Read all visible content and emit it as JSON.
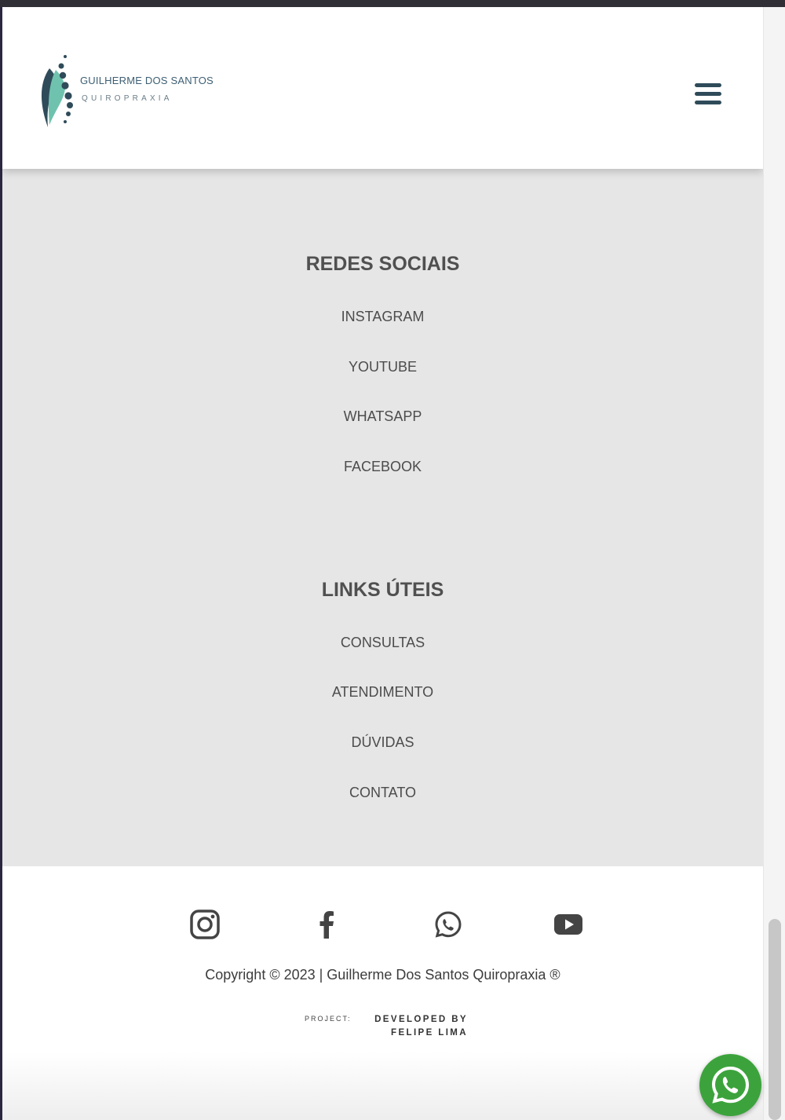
{
  "header": {
    "logo_name": "GUILHERME DOS SANTOS",
    "logo_subtitle": "QUIROPRAXIA",
    "menu_icon": "hamburger-menu-icon"
  },
  "social_column": {
    "title": "REDES SOCIAIS",
    "links": [
      "INSTAGRAM",
      "YOUTUBE",
      "WHATSAPP",
      "FACEBOOK"
    ]
  },
  "useful_column": {
    "title": "LINKS ÚTEIS",
    "links": [
      "CONSULTAS",
      "ATENDIMENTO",
      "DÚVIDAS",
      "CONTATO"
    ]
  },
  "social_icons": [
    "instagram-icon",
    "facebook-icon",
    "whatsapp-icon",
    "youtube-icon"
  ],
  "footer": {
    "copyright": "Copyright © 2023 | Guilherme Dos Santos Quiropraxia ®",
    "credit_label": "PROJECT:",
    "credit_line1": "DEVELOPED BY",
    "credit_line2": "FELIPE LIMA"
  },
  "floating_button": "whatsapp-icon",
  "colors": {
    "header_bg": "#ffffff",
    "links_bg": "#e6e6e6",
    "brand_dark": "#2f4b5a",
    "brand_teal": "#6fc3ae",
    "whatsapp_green": "#3ca33c"
  }
}
